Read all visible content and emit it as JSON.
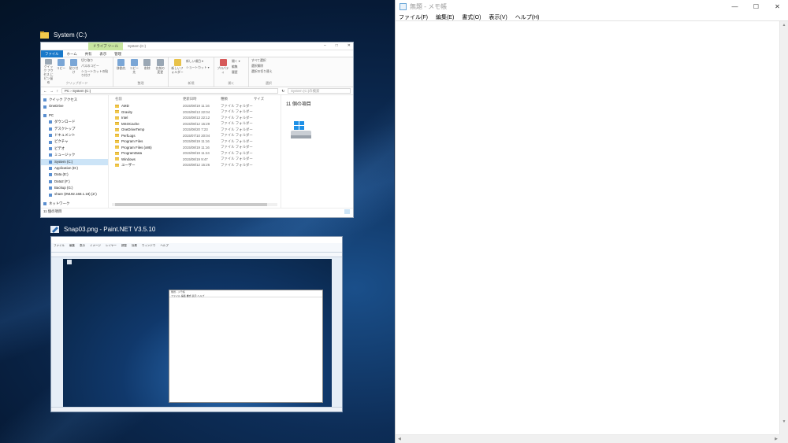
{
  "taskview": {
    "explorer_label": "System (C:)",
    "paint_label": "Snap03.png - Paint.NET V3.5.10"
  },
  "explorer": {
    "tool_tab": "ドライブ ツール",
    "title": "System (C:)",
    "tabs": [
      "ファイル",
      "ホーム",
      "共有",
      "表示",
      "管理"
    ],
    "ribbon": {
      "pin_label": "クイック アクセス にピン留め",
      "copy": "コピー",
      "paste": "貼り付け",
      "cut": "切り取り",
      "copy_path": "パスのコピー",
      "paste_shortcut": "ショートカットの貼り付け",
      "clipboard_group": "クリップボード",
      "move_to": "移動先",
      "copy_to": "コピー先",
      "delete": "削除",
      "rename": "名前の変更",
      "organize_group": "整理",
      "new_item": "新しい項目 ▾",
      "shortcut": "ショートカット ▾",
      "new_folder": "新しいフォルダー",
      "new_group": "新規",
      "properties": "プロパティ",
      "open": "開く ▾",
      "edit": "編集",
      "history": "履歴",
      "open_group": "開く",
      "select_all": "すべて選択",
      "select_none": "選択解除",
      "invert": "選択の切り替え",
      "select_group": "選択"
    },
    "address": "PC › System (C:)",
    "search_placeholder": "System (C:)の検索",
    "nav": [
      {
        "label": "クイック アクセス"
      },
      {
        "label": "OneDrive"
      },
      {
        "label": "PC"
      },
      {
        "label": "ダウンロード"
      },
      {
        "label": "デスクトップ"
      },
      {
        "label": "ドキュメント"
      },
      {
        "label": "ピクチャ"
      },
      {
        "label": "ビデオ"
      },
      {
        "label": "ミュージック"
      },
      {
        "label": "System (C:)"
      },
      {
        "label": "Application (D:)"
      },
      {
        "label": "Data (E:)"
      },
      {
        "label": "Data2 (F:)"
      },
      {
        "label": "Backup (G:)"
      },
      {
        "label": "share (¥¥192.168.1.18) (Z:)"
      },
      {
        "label": "ネットワーク"
      }
    ],
    "columns": [
      "名前",
      "更新日時",
      "種類",
      "サイズ"
    ],
    "rows": [
      {
        "name": "AMD",
        "date": "2015/08/19 11:16",
        "type": "ファイル フォルダー"
      },
      {
        "name": "Gravity",
        "date": "2015/08/13 22:04",
        "type": "ファイル フォルダー"
      },
      {
        "name": "Intel",
        "date": "2015/08/13 22:12",
        "type": "ファイル フォルダー"
      },
      {
        "name": "MSOCache",
        "date": "2015/08/12 15:29",
        "type": "ファイル フォルダー"
      },
      {
        "name": "OneDriveTemp",
        "date": "2015/08/20 7:23",
        "type": "ファイル フォルダー"
      },
      {
        "name": "PerfLogs",
        "date": "2015/07/10 20:04",
        "type": "ファイル フォルダー"
      },
      {
        "name": "Program Files",
        "date": "2015/08/19 11:16",
        "type": "ファイル フォルダー"
      },
      {
        "name": "Program Files (x86)",
        "date": "2015/08/19 11:16",
        "type": "ファイル フォルダー"
      },
      {
        "name": "ProgramData",
        "date": "2015/08/19 11:24",
        "type": "ファイル フォルダー"
      },
      {
        "name": "Windows",
        "date": "2015/08/19 9:47",
        "type": "ファイル フォルダー"
      },
      {
        "name": "ユーザー",
        "date": "2015/08/12 15:26",
        "type": "ファイル フォルダー"
      }
    ],
    "detail_count": "11 個の項目",
    "status": "11 個の項目"
  },
  "paint": {
    "menu": [
      "ファイル",
      "編集",
      "表示",
      "イメージ",
      "レイヤー",
      "調整",
      "効果",
      "ウィンドウ",
      "ヘルプ"
    ],
    "inner_notepad_title": "無題 - メモ帳",
    "inner_notepad_menu": "ファイル  編集  書式  表示  ヘルプ"
  },
  "notepad": {
    "title": "無題 - メモ帳",
    "menu": [
      "ファイル(F)",
      "編集(E)",
      "書式(O)",
      "表示(V)",
      "ヘルプ(H)"
    ],
    "content": ""
  },
  "colors": {
    "accent": "#1979ca",
    "tool_tab": "#c8e6a0",
    "selection": "#cce4f7",
    "folder": "#f2c94c"
  }
}
